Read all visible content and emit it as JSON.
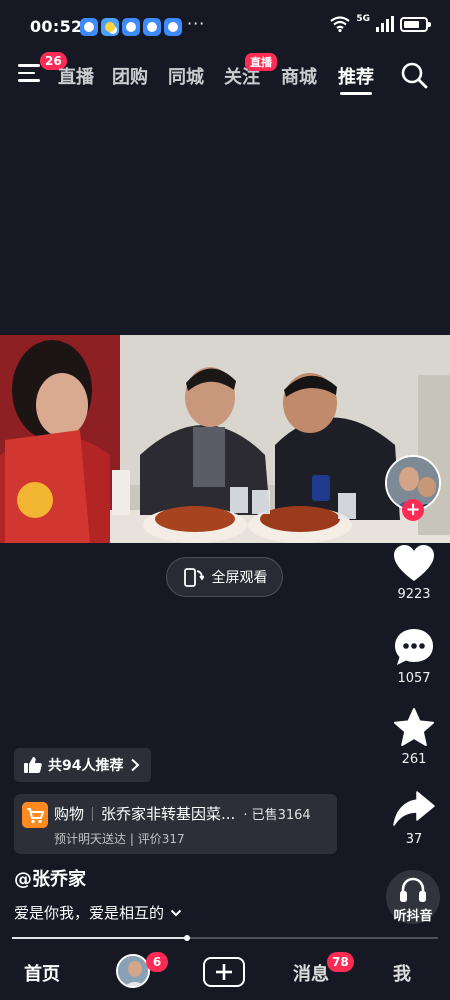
{
  "status_bar": {
    "time": "00:52",
    "network": "5G",
    "overflow": "···"
  },
  "top_nav": {
    "menu_badge": "26",
    "tabs": [
      {
        "label": "直播"
      },
      {
        "label": "团购"
      },
      {
        "label": "同城"
      },
      {
        "label": "关注"
      },
      {
        "label": "商城"
      },
      {
        "label": "推荐"
      }
    ],
    "live_pill": "直播",
    "active_tab": "推荐"
  },
  "video": {
    "fullscreen_label": "全屏观看"
  },
  "actions": {
    "likes": "9223",
    "comments": "1057",
    "favorites": "261",
    "shares": "37"
  },
  "recommend": {
    "label": "共94人推荐"
  },
  "product": {
    "tag": "购物",
    "title": "张乔家非转基因菜...",
    "sold": "· 已售3164",
    "delivery": "预计明天送达",
    "reviews": "评价317"
  },
  "author": "@张乔家",
  "caption": "爱是你我，爱是相互的",
  "listen_label": "听抖音",
  "progress": {
    "played_fraction": 0.41
  },
  "bottom_nav": {
    "home": "首页",
    "friends_badge": "6",
    "messages": "消息",
    "messages_badge": "78",
    "me": "我"
  },
  "colors": {
    "background": "#161823",
    "accent": "#fe2c55",
    "product_orange": "#ff8a1f"
  }
}
